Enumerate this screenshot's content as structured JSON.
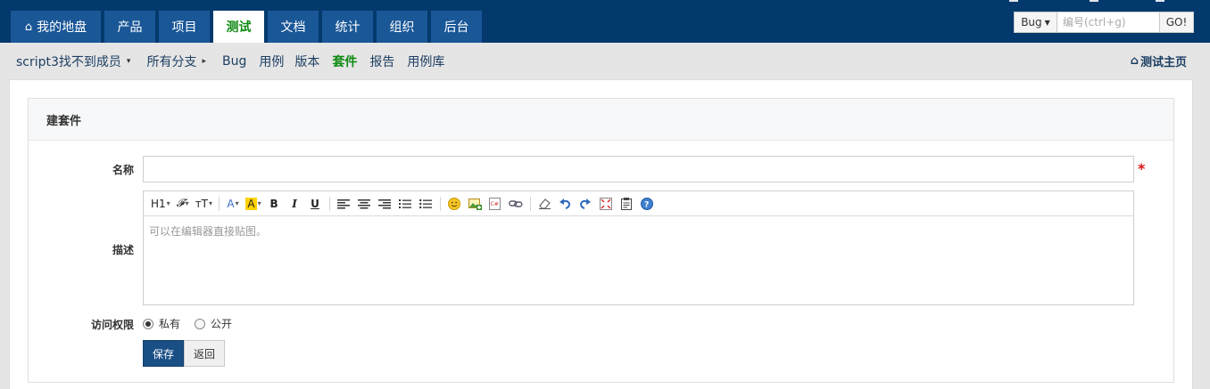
{
  "header": {
    "tabs": [
      {
        "label": "我的地盘",
        "icon": "home-icon"
      },
      {
        "label": "产品"
      },
      {
        "label": "项目"
      },
      {
        "label": "测试",
        "active": true
      },
      {
        "label": "文档"
      },
      {
        "label": "统计"
      },
      {
        "label": "组织"
      },
      {
        "label": "后台"
      }
    ],
    "search": {
      "type_label": "Bug",
      "placeholder": "编号(ctrl+g)",
      "go_label": "GO!"
    }
  },
  "subnav": {
    "items": [
      {
        "label": "script3找不到成员",
        "caret": "▾"
      },
      {
        "label": "所有分支",
        "caret": "▸"
      },
      {
        "label": "Bug"
      },
      {
        "label": "用例"
      },
      {
        "label": "版本"
      },
      {
        "label": "套件",
        "active": true
      },
      {
        "label": "报告"
      },
      {
        "label": "用例库"
      }
    ],
    "right_link": "测试主页"
  },
  "panel": {
    "title": "建套件"
  },
  "form": {
    "name_label": "名称",
    "name_value": "",
    "required_mark": "*",
    "desc_label": "描述",
    "desc_placeholder": "可以在编辑器直接贴图。",
    "acl_label": "访问权限",
    "acl_options": [
      {
        "label": "私有",
        "checked": true
      },
      {
        "label": "公开",
        "checked": false
      }
    ],
    "save_label": "保存",
    "back_label": "返回"
  },
  "toolbar": {
    "heading": "H1",
    "font": "𝓕",
    "size": "тT",
    "color": "A",
    "bgcolor": "A",
    "bold": "B",
    "italic": "I",
    "underline": "U"
  },
  "colors": {
    "topbar": "#03396c",
    "tab": "#1a5797",
    "active_green": "#0e8a12",
    "primary_button": "#1a4f85"
  }
}
